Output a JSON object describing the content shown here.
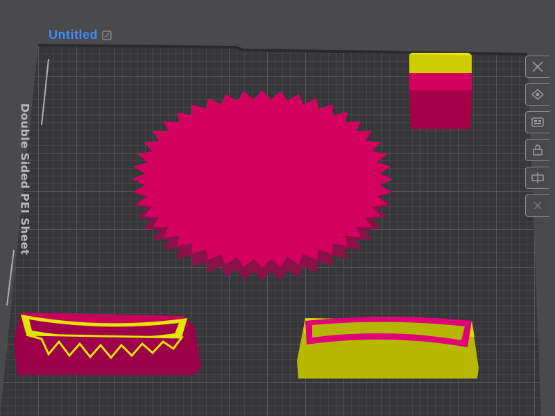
{
  "project": {
    "title": "Untitled"
  },
  "plate": {
    "label": "Double Sided PEI Sheet"
  },
  "colors": {
    "background": "#4a4a4d",
    "plate": "#39393c",
    "grid": "#5a5a5e",
    "magenta": "#d4005f",
    "yellow": "#e0e000",
    "title": "#3d8bff"
  },
  "toolbar": {
    "items": [
      {
        "name": "close-icon"
      },
      {
        "name": "orient-icon"
      },
      {
        "name": "arrange-icon"
      },
      {
        "name": "lock-icon"
      },
      {
        "name": "split-icon"
      },
      {
        "name": "collapse-icon"
      }
    ]
  }
}
